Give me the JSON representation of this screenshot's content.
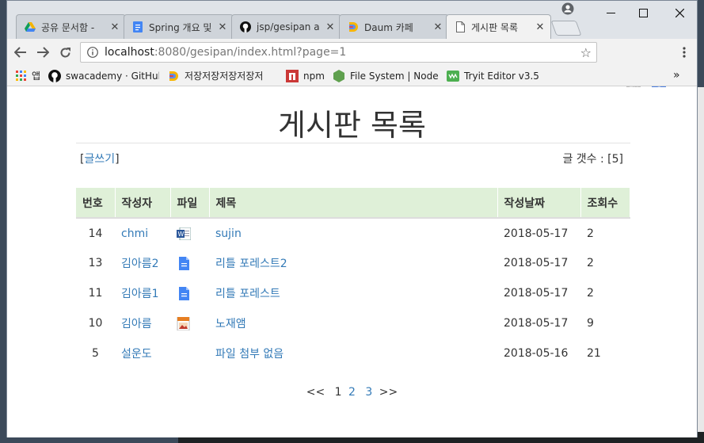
{
  "browser": {
    "tabs": [
      {
        "title": "공유 문서함 -",
        "icon": "google-drive-icon"
      },
      {
        "title": "Spring 개요 및",
        "icon": "google-docs-icon"
      },
      {
        "title": "jsp/gesipan a",
        "icon": "github-icon"
      },
      {
        "title": "Daum 카페",
        "icon": "daum-icon"
      },
      {
        "title": "게시판 목록",
        "icon": "page-icon"
      }
    ],
    "url_host": "localhost",
    "url_path": ":8080/gesipan/index.html?page=1",
    "bookmarks": [
      {
        "label": "앱",
        "icon": "apps-grid-icon"
      },
      {
        "label": "swacademy · GitHub",
        "icon": "github-icon"
      },
      {
        "label": "저장저장저장저장저",
        "icon": "daum-icon"
      },
      {
        "label": "npm",
        "icon": "npm-icon"
      },
      {
        "label": "File System | Node.js",
        "icon": "nodejs-icon"
      },
      {
        "label": "Tryit Editor v3.5",
        "icon": "w3schools-icon"
      }
    ],
    "overflow": "»"
  },
  "page": {
    "title": "게시판 목록",
    "write_link": "글쓰기",
    "write_prefix": "[",
    "write_suffix": "]",
    "count_label": "글 갯수 : [5]",
    "columns": [
      "번호",
      "작성자",
      "파일",
      "제목",
      "작성날짜",
      "조회수"
    ],
    "rows": [
      {
        "no": "14",
        "author": "chmi",
        "file": "word-file-icon",
        "title": "sujin",
        "date": "2018-05-17",
        "views": "2"
      },
      {
        "no": "13",
        "author": "김아름2",
        "file": "doc-file-icon",
        "title": "리틀 포레스트2",
        "date": "2018-05-17",
        "views": "2"
      },
      {
        "no": "11",
        "author": "김아름1",
        "file": "doc-file-icon",
        "title": "리틀 포레스트",
        "date": "2018-05-17",
        "views": "2"
      },
      {
        "no": "10",
        "author": "김아름",
        "file": "image-file-icon",
        "title": "노재앰",
        "date": "2018-05-17",
        "views": "9"
      },
      {
        "no": "5",
        "author": "설운도",
        "file": "",
        "title": "파일 첨부 없음",
        "date": "2018-05-16",
        "views": "21"
      }
    ],
    "pager": {
      "prev": "<<",
      "pages": [
        "1",
        "2",
        "3"
      ],
      "next": ">>"
    }
  }
}
